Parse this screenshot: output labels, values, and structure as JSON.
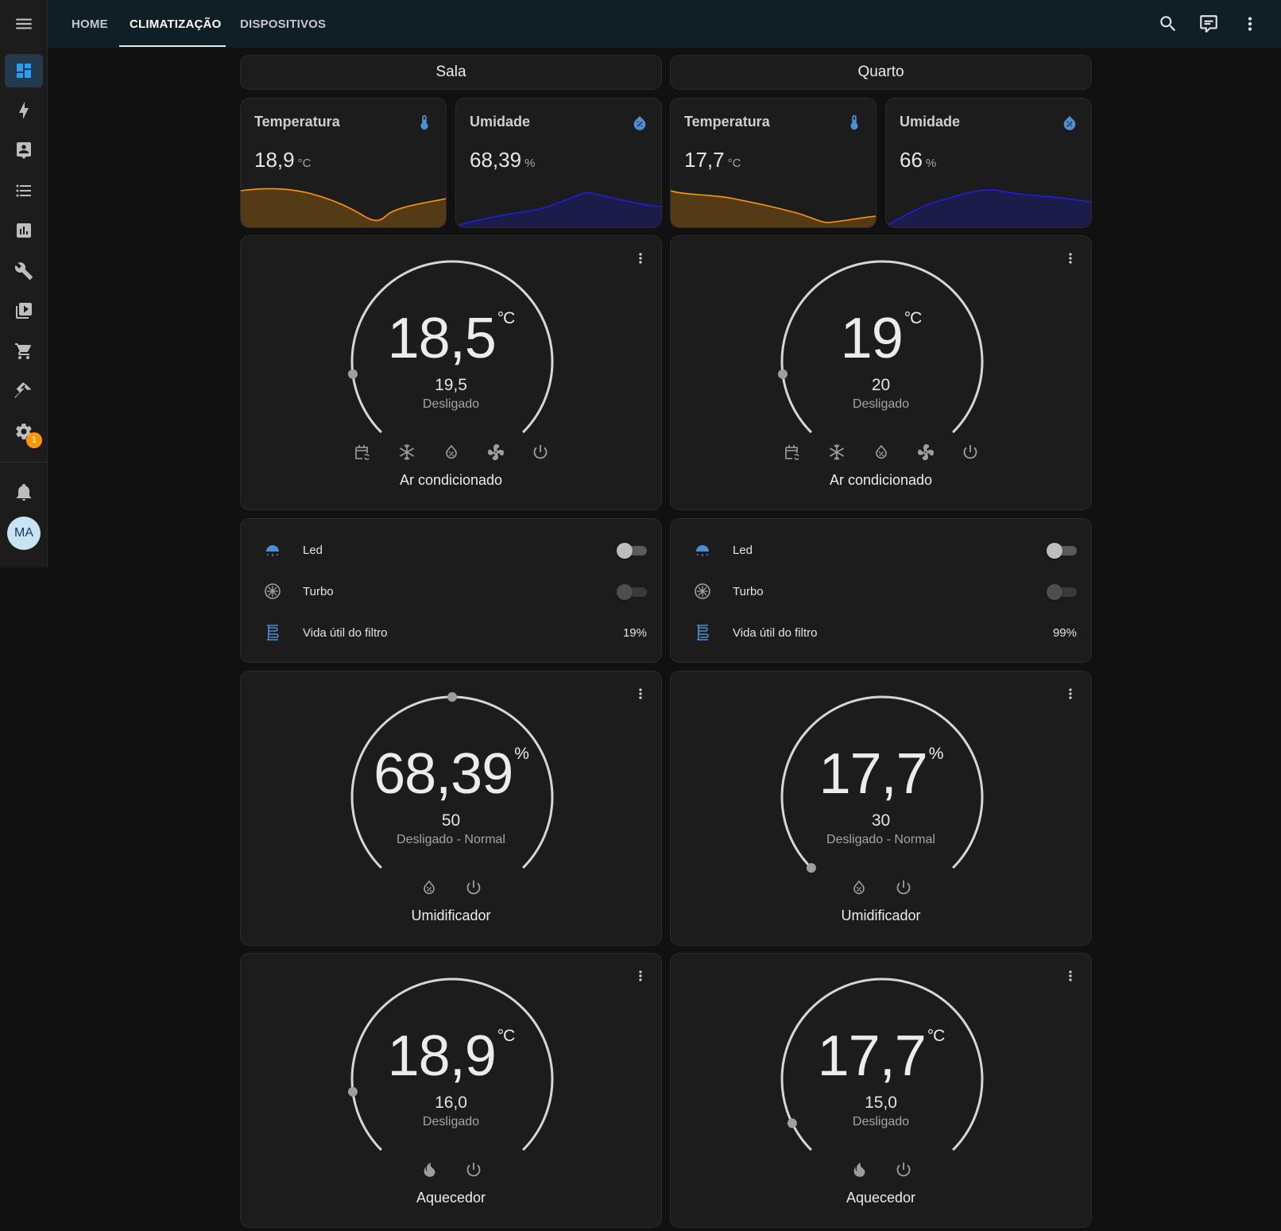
{
  "sidebar": {
    "items": [
      {
        "icon": "dashboard-icon",
        "active": true
      },
      {
        "icon": "energy-icon"
      },
      {
        "icon": "logbook-icon"
      },
      {
        "icon": "list-icon"
      },
      {
        "icon": "history-icon"
      },
      {
        "icon": "wrench-icon"
      },
      {
        "icon": "media-icon"
      },
      {
        "icon": "cart-icon"
      },
      {
        "icon": "hammer-icon"
      },
      {
        "icon": "settings-icon"
      }
    ],
    "settings_badge": "1",
    "avatar_initials": "MA"
  },
  "topbar": {
    "tabs": [
      {
        "label": "HOME"
      },
      {
        "label": "CLIMATIZAÇÃO",
        "active": true
      },
      {
        "label": "DISPOSITIVOS"
      }
    ]
  },
  "rooms": [
    {
      "name": "Sala",
      "sensors": [
        {
          "name": "Temperatura",
          "value": "18,9",
          "unit": "°C",
          "color": "#ff9800",
          "icon": "thermometer-icon"
        },
        {
          "name": "Umidade",
          "value": "68,39",
          "unit": "%",
          "color": "#1e1ee6",
          "icon": "water-percent-icon"
        }
      ],
      "ac": {
        "current": "18,5",
        "unit": "°C",
        "target": "19,5",
        "state": "Desligado",
        "name": "Ar condicionado",
        "level": 0.14
      },
      "entities": {
        "led": {
          "label": "Led",
          "on": false
        },
        "turbo": {
          "label": "Turbo",
          "on": false
        },
        "filter": {
          "label": "Vida útil do filtro",
          "value": "19%"
        }
      },
      "humidifier": {
        "current": "68,39",
        "unit": "%",
        "target": "50",
        "state": "Desligado - Normal",
        "name": "Umidificador",
        "level": 0.5
      },
      "heater": {
        "current": "18,9",
        "unit": "°C",
        "target": "16,0",
        "state": "Desligado",
        "name": "Aquecedor",
        "level": 0.14
      }
    },
    {
      "name": "Quarto",
      "sensors": [
        {
          "name": "Temperatura",
          "value": "17,7",
          "unit": "°C",
          "color": "#ff9800",
          "icon": "thermometer-icon"
        },
        {
          "name": "Umidade",
          "value": "66",
          "unit": "%",
          "color": "#1e1ee6",
          "icon": "water-percent-icon"
        }
      ],
      "ac": {
        "current": "19",
        "unit": "°C",
        "target": "20",
        "state": "Desligado",
        "name": "Ar condicionado",
        "level": 0.14
      },
      "entities": {
        "led": {
          "label": "Led",
          "on": false
        },
        "turbo": {
          "label": "Turbo",
          "on": false
        },
        "filter": {
          "label": "Vida útil do filtro",
          "value": "99%"
        }
      },
      "humidifier": {
        "current": "17,7",
        "unit": "%",
        "target": "30",
        "state": "Desligado - Normal",
        "name": "Umidificador",
        "level": 0.0
      },
      "heater": {
        "current": "17,7",
        "unit": "°C",
        "target": "15,0",
        "state": "Desligado",
        "name": "Aquecedor",
        "level": 0.07
      }
    }
  ]
}
